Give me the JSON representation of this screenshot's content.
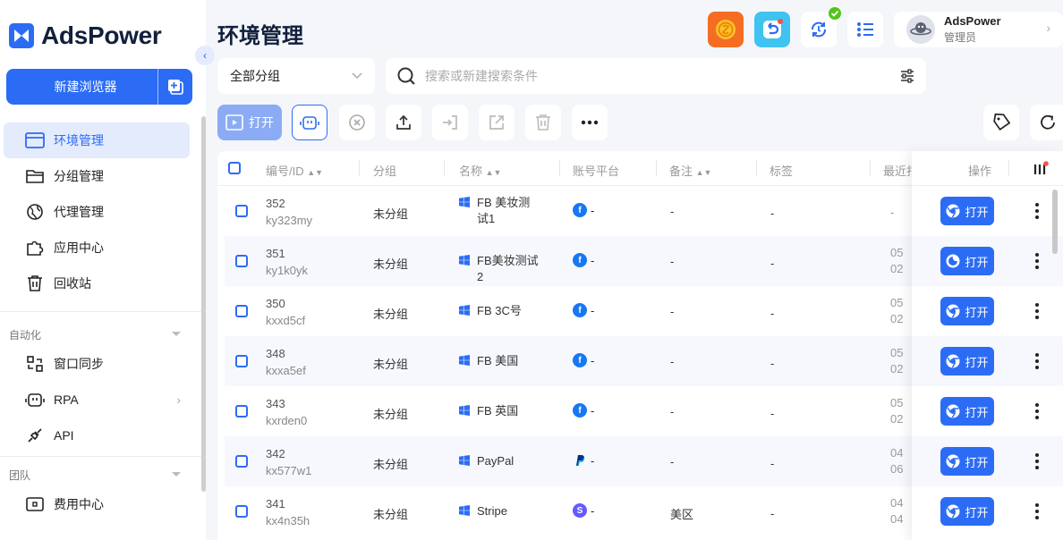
{
  "brand": {
    "name": "AdsPower"
  },
  "sidebar": {
    "new_button": "新建浏览器",
    "items": [
      {
        "label": "环境管理"
      },
      {
        "label": "分组管理"
      },
      {
        "label": "代理管理"
      },
      {
        "label": "应用中心"
      },
      {
        "label": "回收站"
      }
    ],
    "sections": [
      {
        "label": "自动化",
        "items": [
          {
            "label": "窗口同步"
          },
          {
            "label": "RPA"
          },
          {
            "label": "API"
          }
        ]
      },
      {
        "label": "团队",
        "items": [
          {
            "label": "费用中心"
          }
        ]
      }
    ]
  },
  "header": {
    "title": "环境管理",
    "user": {
      "name": "AdsPower",
      "role": "管理员"
    }
  },
  "filters": {
    "group_select": "全部分组",
    "search_placeholder": "搜索或新建搜索条件"
  },
  "toolbar": {
    "open_label": "打开"
  },
  "table": {
    "columns": [
      "编号/ID",
      "分组",
      "名称",
      "账号平台",
      "备注",
      "标签",
      "最近打开",
      "操作"
    ],
    "open_label": "打开",
    "rows": [
      {
        "num": "352",
        "id": "ky323my",
        "group": "未分组",
        "name": "FB 美妆测试1",
        "platform": "facebook",
        "platform_text": "-",
        "remark": "-",
        "tag": "-",
        "last": "-",
        "last2": ""
      },
      {
        "num": "351",
        "id": "ky1k0yk",
        "group": "未分组",
        "name": "FB美妆测试2",
        "platform": "facebook",
        "platform_text": "-",
        "remark": "-",
        "tag": "-",
        "last": "05",
        "last2": "02"
      },
      {
        "num": "350",
        "id": "kxxd5cf",
        "group": "未分组",
        "name": "FB 3C号",
        "platform": "facebook",
        "platform_text": "-",
        "remark": "-",
        "tag": "-",
        "last": "05",
        "last2": "02"
      },
      {
        "num": "348",
        "id": "kxxa5ef",
        "group": "未分组",
        "name": "FB 美国",
        "platform": "facebook",
        "platform_text": "-",
        "remark": "-",
        "tag": "-",
        "last": "05",
        "last2": "02"
      },
      {
        "num": "343",
        "id": "kxrden0",
        "group": "未分组",
        "name": "FB 英国",
        "platform": "facebook",
        "platform_text": "-",
        "remark": "-",
        "tag": "-",
        "last": "05",
        "last2": "02"
      },
      {
        "num": "342",
        "id": "kx577w1",
        "group": "未分组",
        "name": "PayPal",
        "platform": "paypal",
        "platform_text": "-",
        "remark": "-",
        "tag": "-",
        "last": "04",
        "last2": "06"
      },
      {
        "num": "341",
        "id": "kx4n35h",
        "group": "未分组",
        "name": "Stripe",
        "platform": "stripe",
        "platform_text": "-",
        "remark": "美区",
        "tag": "-",
        "last": "04",
        "last2": "04"
      }
    ]
  },
  "colors": {
    "accent": "#2c6cf5",
    "facebook": "#1877f2",
    "paypal": "#003087",
    "stripe": "#635bff"
  }
}
